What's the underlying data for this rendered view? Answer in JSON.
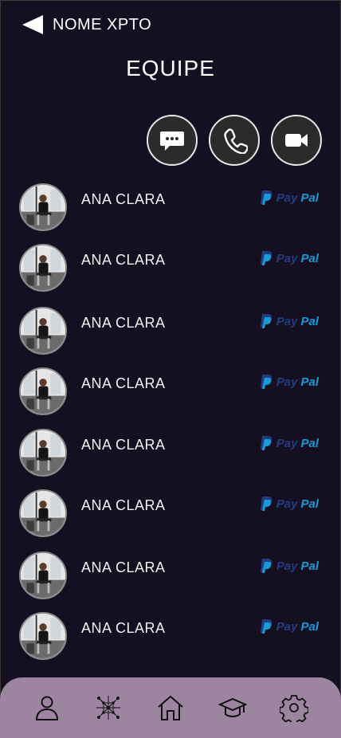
{
  "header": {
    "back_icon": "back-triangle-icon",
    "name": "NOME XPTO"
  },
  "page": {
    "title": "EQUIPE"
  },
  "actions": [
    {
      "id": "chat",
      "icon": "chat-bubble-icon"
    },
    {
      "id": "call",
      "icon": "phone-icon"
    },
    {
      "id": "video",
      "icon": "video-camera-icon"
    }
  ],
  "members": [
    {
      "name": "ANA CLARA",
      "payment": {
        "pay": "Pay",
        "pal": "Pal"
      }
    },
    {
      "name": "ANA CLARA",
      "payment": {
        "pay": "Pay",
        "pal": "Pal"
      }
    },
    {
      "name": "ANA CLARA",
      "payment": {
        "pay": "Pay",
        "pal": "Pal"
      }
    },
    {
      "name": "ANA CLARA",
      "payment": {
        "pay": "Pay",
        "pal": "Pal"
      }
    },
    {
      "name": "ANA CLARA",
      "payment": {
        "pay": "Pay",
        "pal": "Pal"
      }
    },
    {
      "name": "ANA CLARA",
      "payment": {
        "pay": "Pay",
        "pal": "Pal"
      }
    },
    {
      "name": "ANA CLARA",
      "payment": {
        "pay": "Pay",
        "pal": "Pal"
      }
    },
    {
      "name": "ANA CLARA",
      "payment": {
        "pay": "Pay",
        "pal": "Pal"
      }
    }
  ],
  "bottom_nav": [
    {
      "id": "profile",
      "icon": "user-icon"
    },
    {
      "id": "network",
      "icon": "network-icon"
    },
    {
      "id": "home",
      "icon": "home-icon"
    },
    {
      "id": "education",
      "icon": "graduation-cap-icon"
    },
    {
      "id": "settings",
      "icon": "gear-icon"
    }
  ],
  "colors": {
    "background": "#141022",
    "nav_background": "#9d84a1",
    "button_background": "#2b2b2b",
    "paypal_dark": "#253b80",
    "paypal_light": "#179bd7"
  }
}
